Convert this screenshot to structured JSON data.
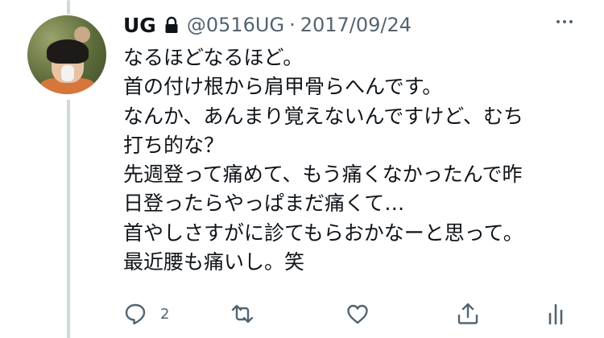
{
  "tweet": {
    "author_name": "UG",
    "handle": "@0516UG",
    "separator": "·",
    "date": "2017/09/24",
    "lines": [
      "なるほどなるほど。",
      "首の付け根から肩甲骨らへんです。",
      "なんか、あんまり覚えないんですけど、むち",
      "打ち的な？",
      "先週登って痛めて、もう痛くなかったんで昨",
      "日登ったらやっぱまだ痛くて…",
      "首やしさすがに診てもらおかなーと思って。",
      "最近腰も痛いし。笑"
    ]
  },
  "actions": {
    "reply_count": "2",
    "icons": [
      "reply-icon",
      "retweet-icon",
      "like-icon",
      "share-icon",
      "analytics-icon"
    ]
  },
  "colors": {
    "text": "#0f1419",
    "secondary": "#536471",
    "thread_line": "#cfd9de"
  }
}
